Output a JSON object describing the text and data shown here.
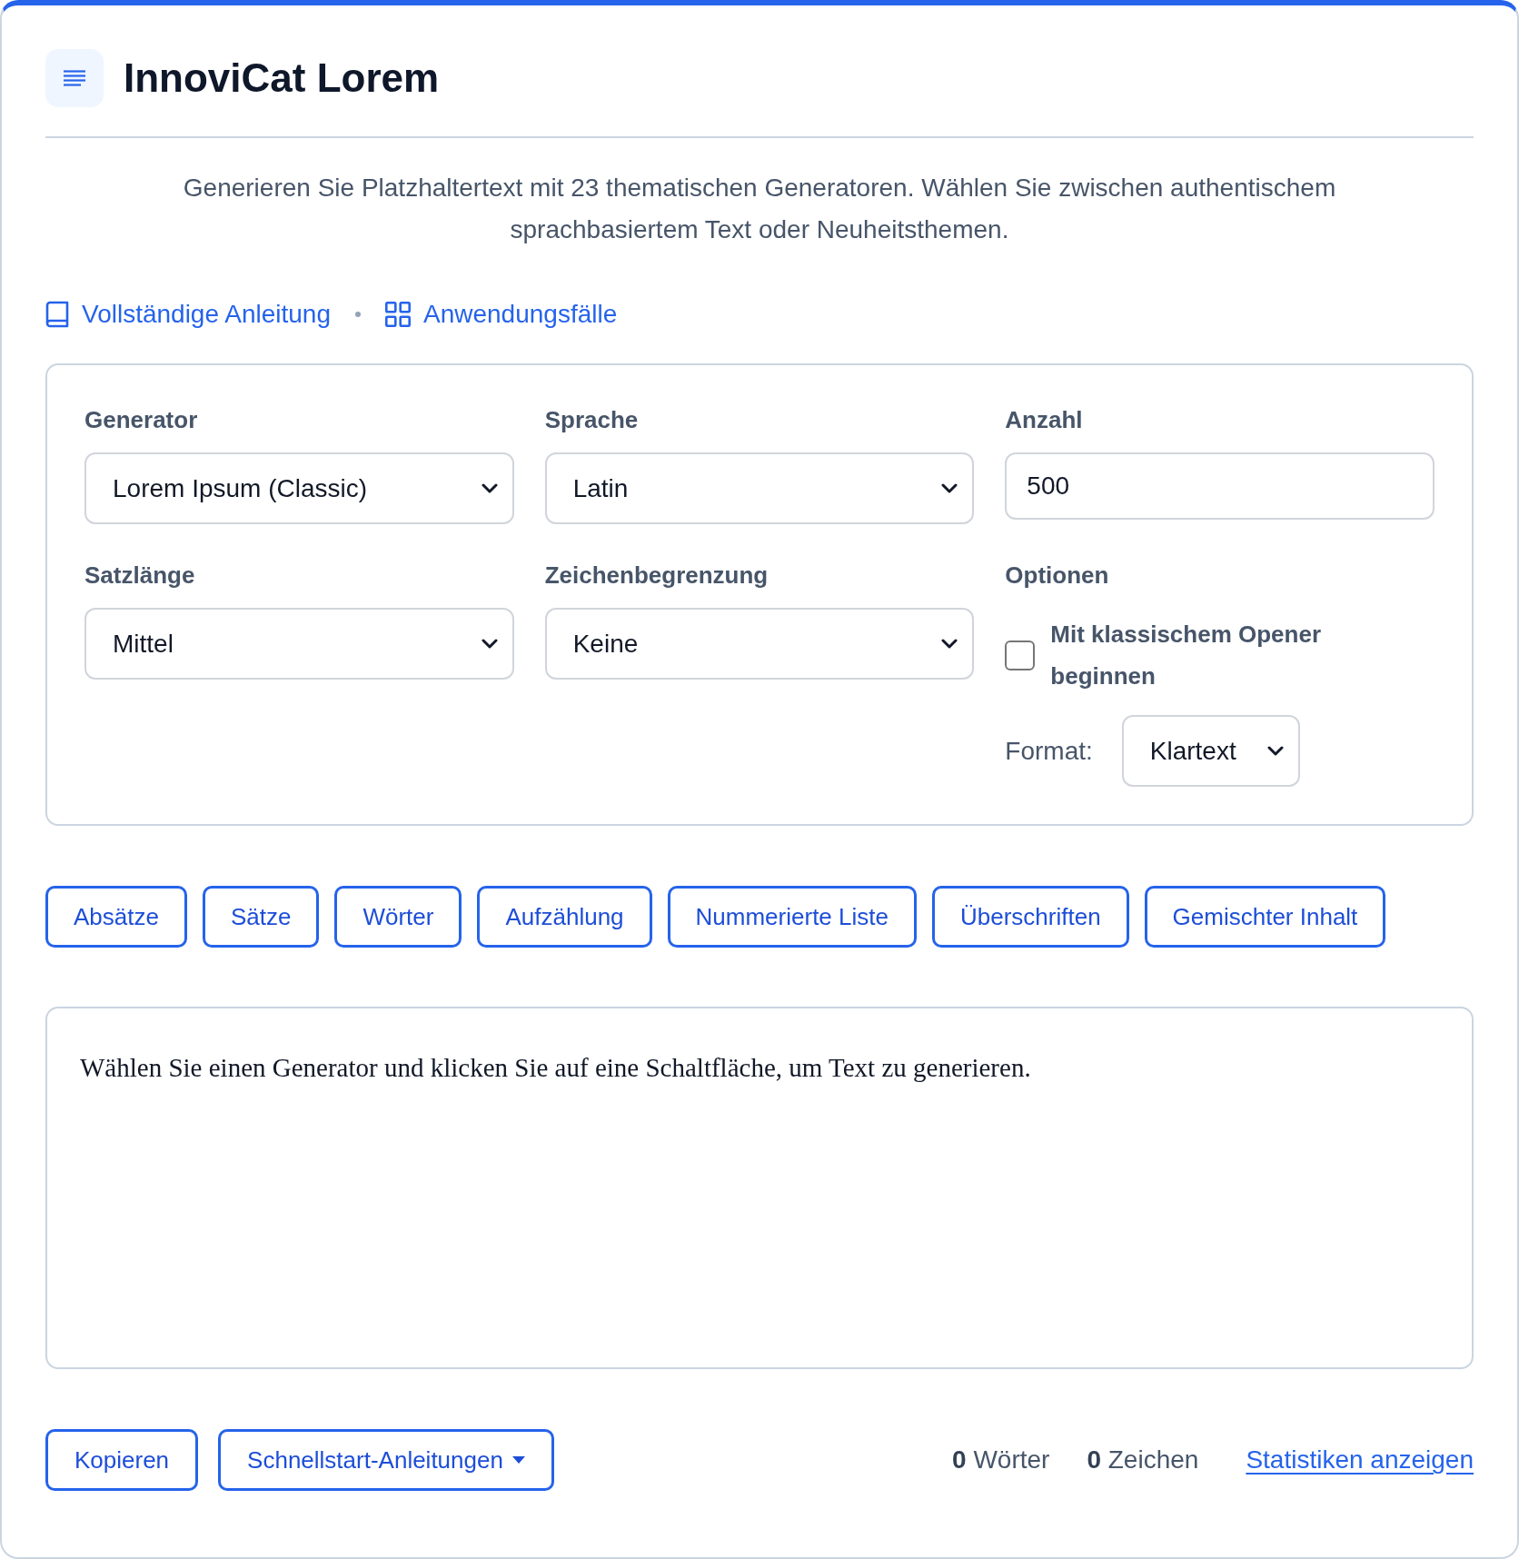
{
  "header": {
    "title": "InnoviCat Lorem"
  },
  "description": "Generieren Sie Platzhaltertext mit 23 thematischen Generatoren. Wählen Sie zwischen authentischem sprachbasiertem Text oder Neuheitsthemen.",
  "links": [
    {
      "kind": "guide",
      "label": "Vollständige Anleitung"
    },
    {
      "kind": "examples",
      "label": "Anwendungsfälle"
    }
  ],
  "settings": {
    "fields": [
      {
        "kind": "select",
        "label": "Generator",
        "value": "Lorem Ipsum (Classic)"
      },
      {
        "kind": "select",
        "label": "Sprache",
        "value": "Latin"
      },
      {
        "kind": "input",
        "label": "Anzahl",
        "value": "500"
      },
      {
        "kind": "select",
        "label": "Satzlänge",
        "value": "Mittel"
      },
      {
        "kind": "select",
        "label": "Zeichenbegrenzung",
        "value": "Keine"
      },
      {
        "kind": "options",
        "label": "Optionen",
        "checkbox": {
          "label": "Mit klassischem Opener beginnen",
          "checked": false
        },
        "format": {
          "label": "Format:",
          "value": "Klartext"
        }
      }
    ]
  },
  "actions": [
    "Absätze",
    "Sätze",
    "Wörter",
    "Aufzählung",
    "Nummerierte Liste",
    "Überschriften",
    "Gemischter Inhalt"
  ],
  "output": {
    "text": "Wählen Sie einen Generator und klicken Sie auf eine Schaltfläche, um Text zu generieren."
  },
  "footer": {
    "buttons": [
      {
        "kind": "button",
        "label": "Kopieren"
      },
      {
        "kind": "dropdown",
        "label": "Schnellstart-Anleitungen"
      }
    ],
    "stats": [
      {
        "count": "0",
        "label": "Wörter"
      },
      {
        "count": "0",
        "label": "Zeichen"
      }
    ],
    "link": "Statistiken anzeigen"
  }
}
